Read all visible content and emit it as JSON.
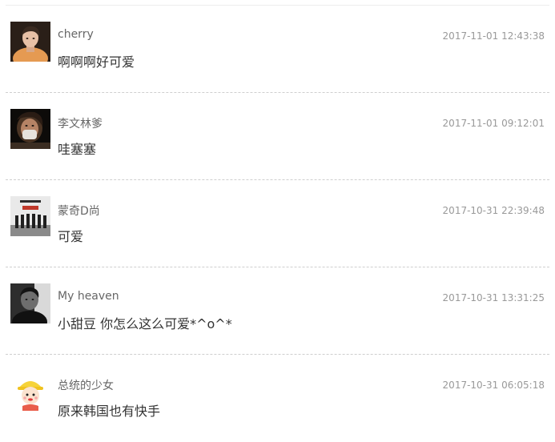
{
  "comments": [
    {
      "username": "cherry",
      "timestamp": "2017-11-01 12:43:38",
      "text": "啊啊啊好可爱",
      "avatar_icon": "portrait-photo"
    },
    {
      "username": "李文林爹",
      "timestamp": "2017-11-01 09:12:01",
      "text": "哇塞塞",
      "avatar_icon": "masked-portrait-photo"
    },
    {
      "username": "蒙奇D尚",
      "timestamp": "2017-10-31 22:39:48",
      "text": "可爱",
      "avatar_icon": "band-poster-photo"
    },
    {
      "username": "My heaven",
      "timestamp": "2017-10-31 13:31:25",
      "text": "小甜豆 你怎么这么可爱*^o^*",
      "avatar_icon": "monochrome-portrait-photo"
    },
    {
      "username": "总统的少女",
      "timestamp": "2017-10-31 06:05:18",
      "text": "原来韩国也有快手",
      "avatar_icon": "cartoon-child-avatar"
    }
  ],
  "colors": {
    "username": "#666666",
    "timestamp": "#999999",
    "text": "#333333",
    "divider": "#cfcfcf"
  }
}
